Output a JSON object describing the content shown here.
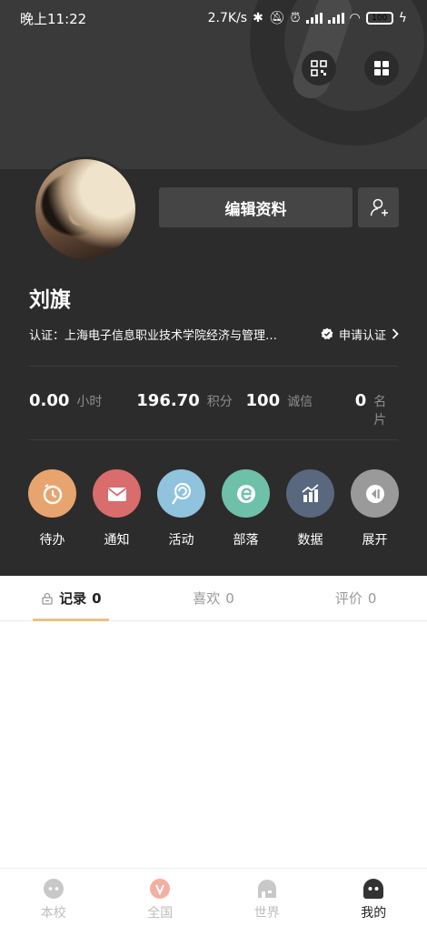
{
  "status_bar": {
    "time": "晚上11:22",
    "speed": "2.7K/s",
    "battery": "100"
  },
  "profile": {
    "edit_label": "编辑资料",
    "name": "刘旗",
    "certification": "认证：上海电子信息职业技术学院经济与管理…",
    "apply_cert": "申请认证"
  },
  "stats": [
    {
      "value": "0.00",
      "label": "小时"
    },
    {
      "value": "196.70",
      "label": "积分"
    },
    {
      "value": "100",
      "label": "诚信"
    },
    {
      "value": "0",
      "label": "名片"
    }
  ],
  "quick_actions": [
    {
      "label": "待办",
      "color": "#e8a46e",
      "icon": "clock-icon"
    },
    {
      "label": "通知",
      "color": "#d96c6c",
      "icon": "mail-icon"
    },
    {
      "label": "活动",
      "color": "#8fc3de",
      "icon": "lollipop-icon"
    },
    {
      "label": "部落",
      "color": "#6fc0a8",
      "icon": "tribe-icon"
    },
    {
      "label": "数据",
      "color": "#59677f",
      "icon": "chart-icon"
    },
    {
      "label": "展开",
      "color": "#9a9a9a",
      "icon": "expand-icon"
    }
  ],
  "tabs": [
    {
      "label": "记录",
      "count": "0",
      "active": true
    },
    {
      "label": "喜欢",
      "count": "0",
      "active": false
    },
    {
      "label": "评价",
      "count": "0",
      "active": false
    }
  ],
  "bottom_nav": [
    {
      "label": "本校",
      "active": false
    },
    {
      "label": "全国",
      "active": false
    },
    {
      "label": "世界",
      "active": false
    },
    {
      "label": "我的",
      "active": true
    }
  ],
  "colors": {
    "accent": "#e9c283",
    "panel": "#2c2c2c"
  }
}
